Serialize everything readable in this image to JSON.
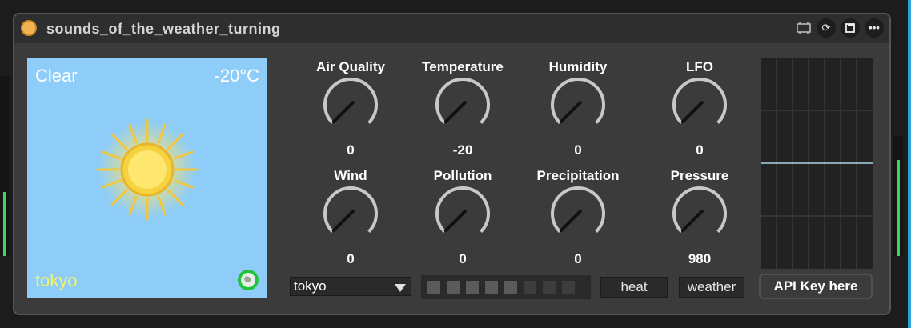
{
  "device": {
    "title": "sounds_of_the_weather_turning"
  },
  "weather": {
    "condition": "Clear",
    "temperature_display": "-20°C",
    "city": "tokyo"
  },
  "knobs": [
    {
      "label": "Air Quality",
      "value": "0",
      "fraction": 0.0
    },
    {
      "label": "Temperature",
      "value": "-20",
      "fraction": 0.0
    },
    {
      "label": "Humidity",
      "value": "0",
      "fraction": 0.0
    },
    {
      "label": "LFO",
      "value": "0",
      "fraction": 0.0
    },
    {
      "label": "Wind",
      "value": "0",
      "fraction": 0.0
    },
    {
      "label": "Pollution",
      "value": "0",
      "fraction": 0.0
    },
    {
      "label": "Precipitation",
      "value": "0",
      "fraction": 0.0
    },
    {
      "label": "Pressure",
      "value": "980",
      "fraction": 0.0
    }
  ],
  "city_select": {
    "value": "tokyo"
  },
  "step_indicator": {
    "total": 8,
    "highlighted": 5
  },
  "buttons": {
    "heat": "heat",
    "weather": "weather",
    "api_key": "API Key here"
  },
  "colors": {
    "accent": "#2aa5d6",
    "power": "#f3b353",
    "sky": "#8ecdf8",
    "city_text": "#f6f169",
    "meter_green": "#3bd65a"
  }
}
